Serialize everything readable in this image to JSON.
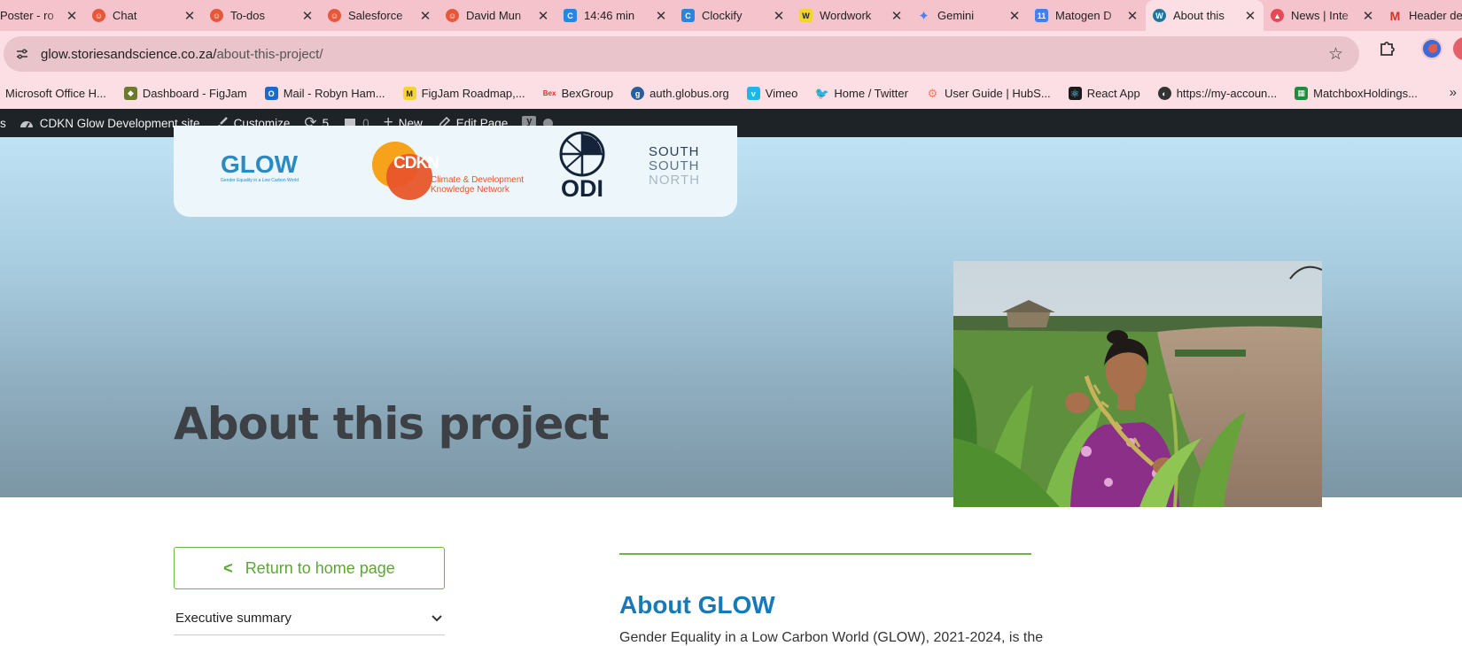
{
  "browser": {
    "tabs": [
      {
        "title": "Poster - ro",
        "icon": "tab-favicon"
      },
      {
        "title": "Chat",
        "icon": "chat-favicon"
      },
      {
        "title": "To-dos",
        "icon": "todos-favicon"
      },
      {
        "title": "Salesforce",
        "icon": "salesforce-favicon"
      },
      {
        "title": "David Mun",
        "icon": "contact-favicon"
      },
      {
        "title": "14:46 min",
        "icon": "timer-favicon"
      },
      {
        "title": "Clockify",
        "icon": "clockify-favicon"
      },
      {
        "title": "Wordwork",
        "icon": "wordwork-favicon"
      },
      {
        "title": "Gemini",
        "icon": "gemini-favicon"
      },
      {
        "title": "Matogen D",
        "icon": "calendar-favicon"
      },
      {
        "title": "About this",
        "icon": "wordpress-favicon"
      },
      {
        "title": "News | Inte",
        "icon": "news-favicon"
      },
      {
        "title": "Header de",
        "icon": "gmail-favicon"
      }
    ],
    "url_host": "glow.storiesandscience.co.za/",
    "url_path": "about-this-project/"
  },
  "bookmarks": [
    {
      "label": "Microsoft Office H...",
      "icon": "office-icon",
      "color": ""
    },
    {
      "label": "Dashboard - FigJam",
      "icon": "figjam-icon",
      "color": "#6b7b2a"
    },
    {
      "label": "Mail - Robyn Ham...",
      "icon": "outlook-icon",
      "color": "#1b6ac9"
    },
    {
      "label": "FigJam Roadmap,...",
      "icon": "miro-icon",
      "color": "#f5d431"
    },
    {
      "label": "BexGroup",
      "icon": "bex-icon",
      "color": "#e32b2b"
    },
    {
      "label": "auth.globus.org",
      "icon": "globus-icon",
      "color": "#2a5d9b"
    },
    {
      "label": "Vimeo",
      "icon": "vimeo-icon",
      "color": "#1ab7ea"
    },
    {
      "label": "Home / Twitter",
      "icon": "twitter-icon",
      "color": "#1d9bf0"
    },
    {
      "label": "User Guide | HubS...",
      "icon": "hubspot-icon",
      "color": "#ff7a59"
    },
    {
      "label": "React App",
      "icon": "react-icon",
      "color": "#1b1b1b"
    },
    {
      "label": "https://my-accoun...",
      "icon": "globe-icon",
      "color": "#333"
    },
    {
      "label": "MatchboxHoldings...",
      "icon": "sheets-icon",
      "color": "#1e8e3e"
    }
  ],
  "adminbar": {
    "site_name": "CDKN Glow Development site",
    "customize": "Customize",
    "updates": "5",
    "comments": "0",
    "new": "New",
    "edit_page": "Edit Page"
  },
  "logos": {
    "glow": "GLOW",
    "glow_tagline": "Gender Equality in a Low Carbon World",
    "cdkn": "CDKN",
    "cdkn_line1": "Climate & Development",
    "cdkn_line2": "Knowledge Network",
    "odi": "ODI",
    "ssn1": "SOUTH",
    "ssn2": "SOUTH",
    "ssn3": "NORTH"
  },
  "hero": {
    "title": "About this project"
  },
  "sidebar": {
    "return_label": "Return to home page",
    "accordion_label": "Executive summary"
  },
  "main": {
    "heading": "About GLOW",
    "intro": "Gender Equality in a Low Carbon World (GLOW), 2021-2024, is the"
  },
  "colors": {
    "accent_green": "#6fb343",
    "heading_blue": "#1679b8",
    "admin_bg": "#1d2327"
  }
}
